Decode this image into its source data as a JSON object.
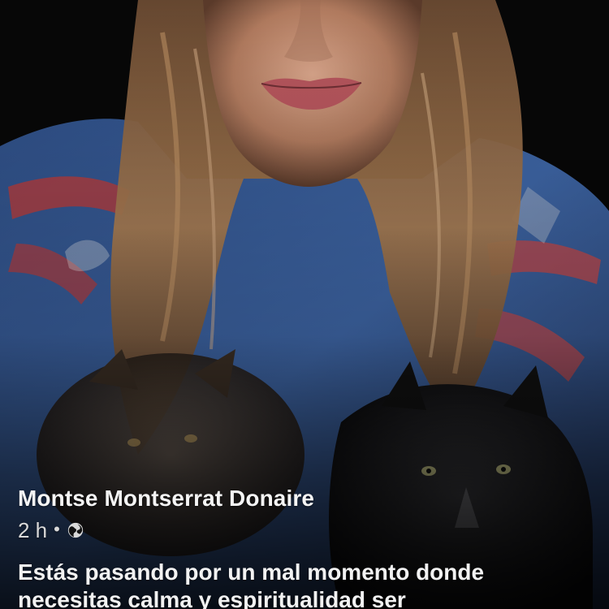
{
  "post": {
    "author": "Montse Montserrat Donaire",
    "time": "2 h",
    "separator": "•",
    "audience_icon": "globe-icon",
    "caption_lines": [
      "Estás pasando por un mal momento donde",
      "necesitas calma y espiritualidad ser"
    ]
  },
  "colors": {
    "background": "#050505",
    "text": "#f2f2f2",
    "meta_text": "#d9d9d9"
  }
}
